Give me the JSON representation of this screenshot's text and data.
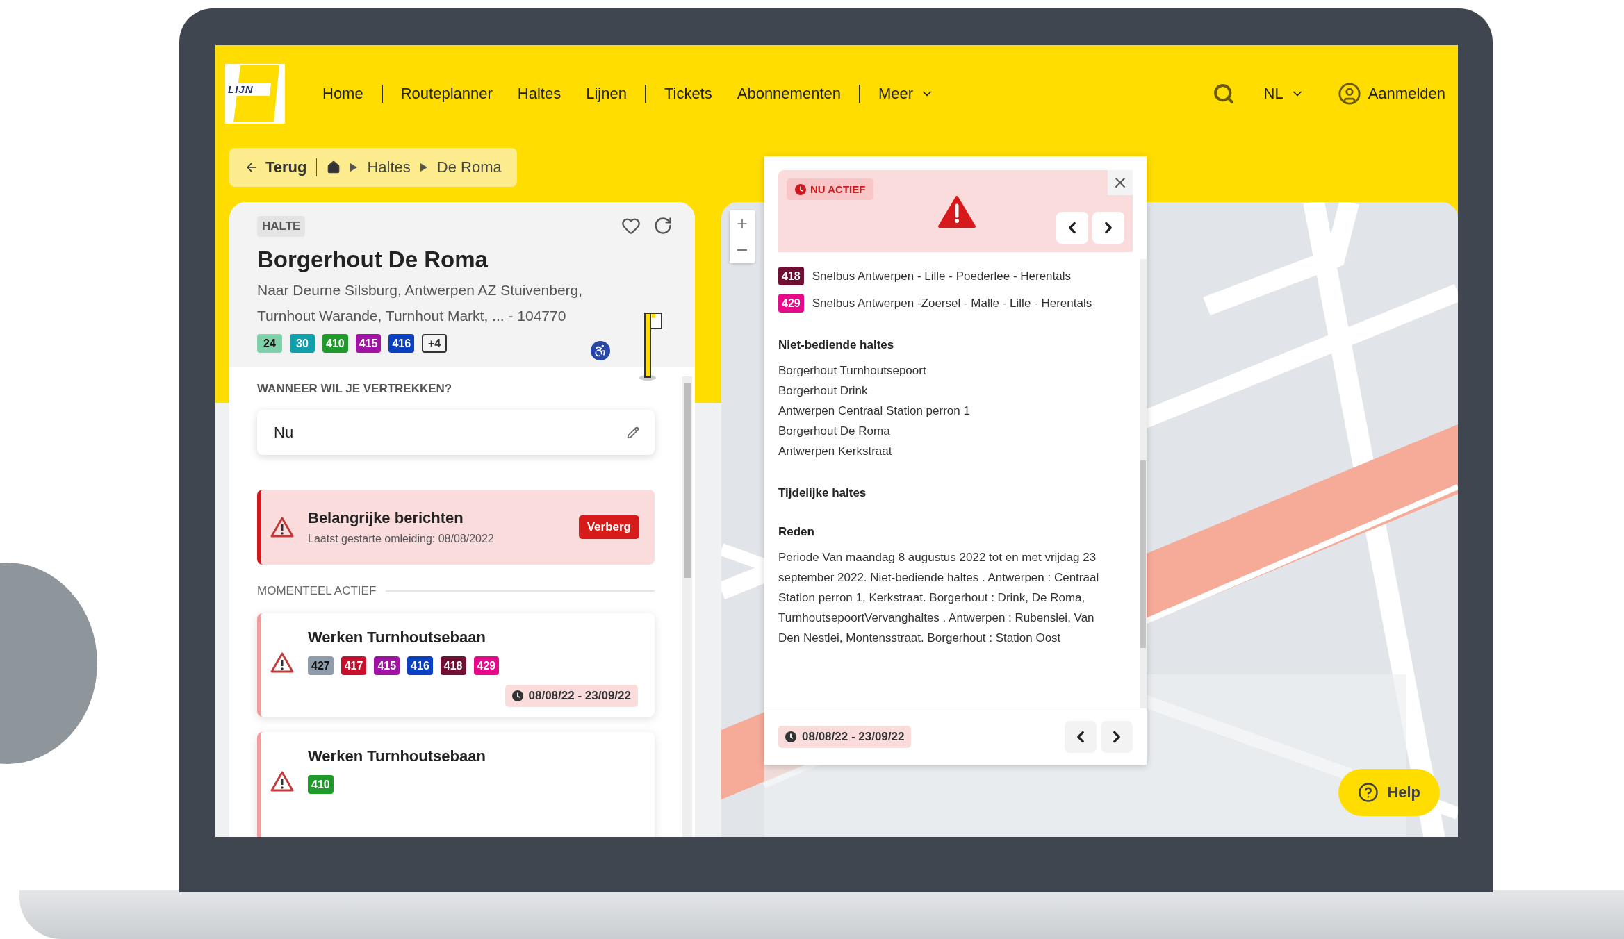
{
  "header": {
    "nav_groups": [
      [
        {
          "label": "Home",
          "kind": "link"
        }
      ],
      [
        {
          "label": "Routeplanner",
          "kind": "link"
        },
        {
          "label": "Haltes",
          "kind": "link"
        },
        {
          "label": "Lijnen",
          "kind": "link"
        }
      ],
      [
        {
          "label": "Tickets",
          "kind": "link"
        },
        {
          "label": "Abonnementen",
          "kind": "link"
        }
      ],
      [
        {
          "label": "Meer",
          "kind": "menu"
        }
      ]
    ],
    "language": "NL",
    "login": "Aanmelden",
    "logo_text": "LIJN"
  },
  "breadcrumb": {
    "back": "Terug",
    "items": [
      "Haltes",
      "De Roma"
    ]
  },
  "stop": {
    "tag": "HALTE",
    "name": "Borgerhout De Roma",
    "directions": "Naar Deurne Silsburg, Antwerpen AZ Stuivenberg, Turnhout Warande, Turnhout Markt, ... - 104770",
    "lines": [
      {
        "number": "24",
        "color": "#7fd1a9"
      },
      {
        "number": "30",
        "color": "#10a0ab"
      },
      {
        "number": "410",
        "color": "#1f9a2b"
      },
      {
        "number": "415",
        "color": "#a014a4"
      },
      {
        "number": "416",
        "color": "#0a40c2"
      }
    ],
    "more": "+4",
    "wheelchair_accessible": true
  },
  "departure": {
    "label": "WANNEER WIL JE VERTREKKEN?",
    "value": "Nu"
  },
  "notice": {
    "title": "Belangrijke berichten",
    "subtitle": "Laatst gestarte omleiding: 08/08/2022",
    "button": "Verberg"
  },
  "section_label": "MOMENTEEL ACTIEF",
  "disruptions": [
    {
      "title": "Werken Turnhoutsebaan",
      "lines": [
        {
          "number": "427",
          "color": "#8e9cab"
        },
        {
          "number": "417",
          "color": "#c8102e"
        },
        {
          "number": "415",
          "color": "#a014a4"
        },
        {
          "number": "416",
          "color": "#0a40c2"
        },
        {
          "number": "418",
          "color": "#6e0f33"
        },
        {
          "number": "429",
          "color": "#e6098a"
        }
      ],
      "period": "08/08/22 - 23/09/22"
    },
    {
      "title": "Werken Turnhoutsebaan",
      "lines": [
        {
          "number": "410",
          "color": "#1f9a2b"
        }
      ]
    }
  ],
  "popup": {
    "status": "NU ACTIEF",
    "lines": [
      {
        "number": "418",
        "color": "#6e0f33",
        "route": "Snelbus Antwerpen - Lille - Poederlee - Herentals"
      },
      {
        "number": "429",
        "color": "#e6098a",
        "route": "Snelbus Antwerpen -Zoersel - Malle - Lille - Herentals"
      }
    ],
    "sections": [
      {
        "heading": "Niet-bediende haltes",
        "items": [
          "Borgerhout Turnhoutsepoort",
          "Borgerhout Drink",
          "Antwerpen Centraal Station perron 1",
          "Borgerhout De Roma",
          "Antwerpen Kerkstraat"
        ]
      },
      {
        "heading": "Tijdelijke haltes"
      },
      {
        "heading": "Reden",
        "text": "Periode Van maandag 8 augustus 2022 tot en met vrijdag 23 september 2022. Niet-bediende haltes . Antwerpen : Centraal Station perron 1, Kerkstraat. Borgerhout : Drink, De Roma, TurnhoutsepoortVervanghaltes . Antwerpen : Rubenslei, Van Den Nestlei, Montensstraat. Borgerhout : Station Oost"
      }
    ],
    "period": "08/08/22 - 23/09/22"
  },
  "help": "Help"
}
